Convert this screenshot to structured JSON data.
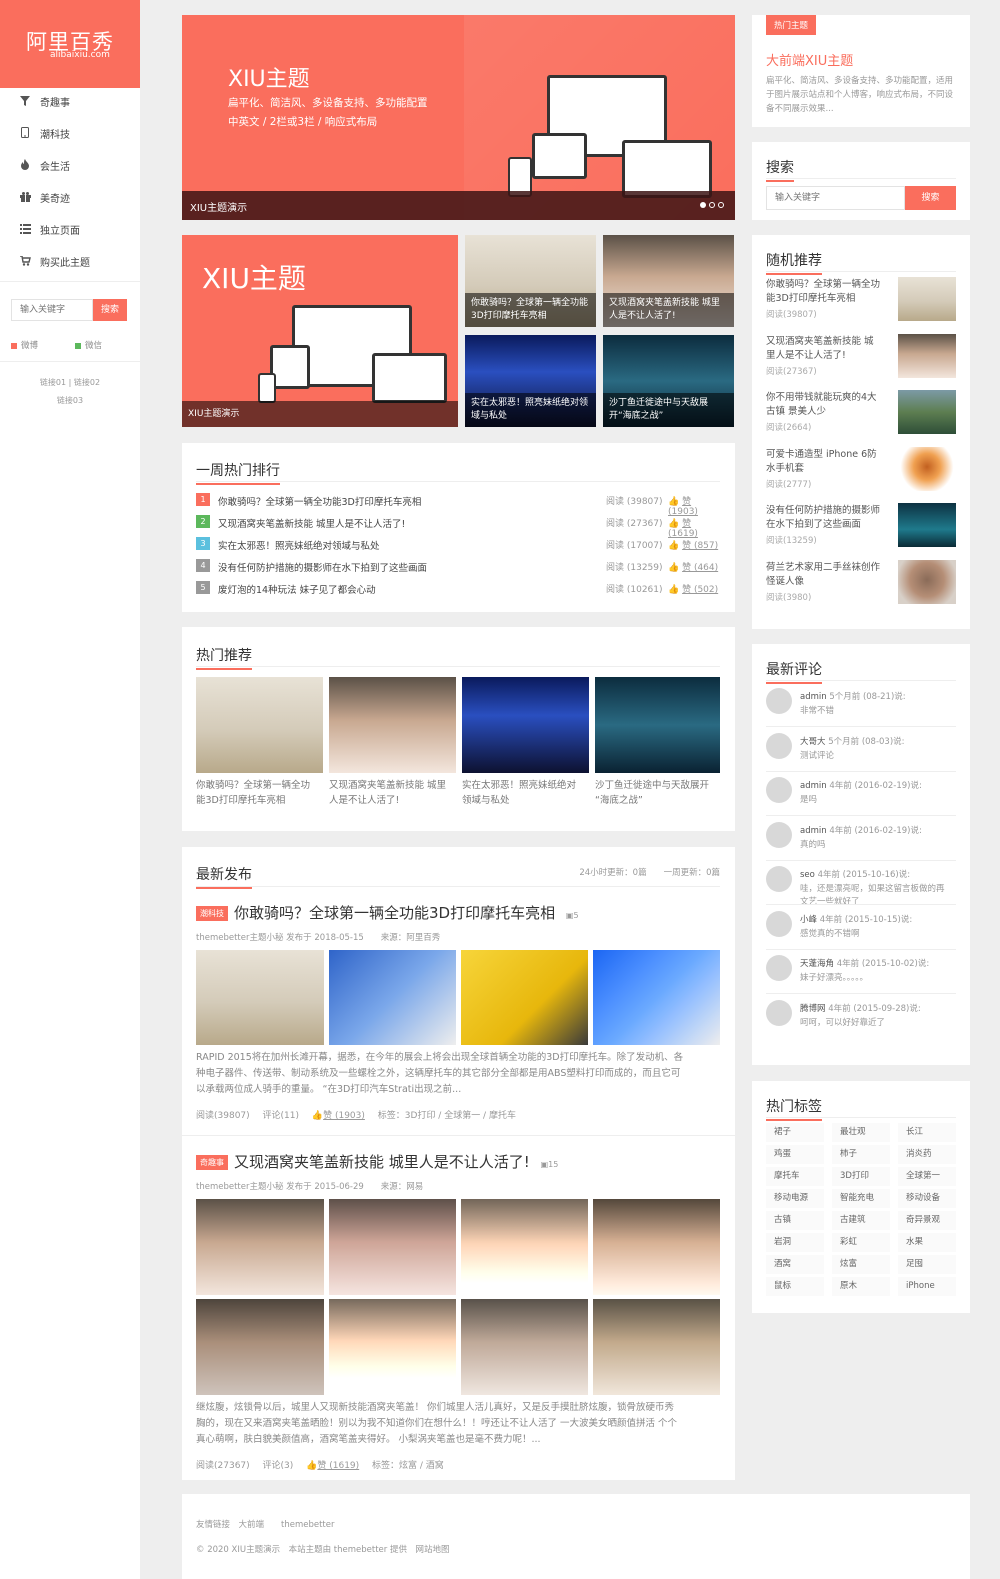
{
  "logo": {
    "title": "阿里百秀",
    "subtitle": "alibaixiu.com"
  },
  "nav": [
    {
      "icon": "filter-icon",
      "label": "奇趣事"
    },
    {
      "icon": "mobile-icon",
      "label": "潮科技"
    },
    {
      "icon": "fire-icon",
      "label": "会生活"
    },
    {
      "icon": "gift-icon",
      "label": "美奇迹"
    },
    {
      "icon": "list-icon",
      "label": "独立页面"
    },
    {
      "icon": "cart-icon",
      "label": "购买此主题"
    }
  ],
  "left_search": {
    "placeholder": "输入关键字",
    "button": "搜索"
  },
  "social": {
    "weibo": "微博",
    "weixin": "微信"
  },
  "left_links": {
    "line1": "链接01 | 链接02",
    "line2": "链接03"
  },
  "slider": {
    "heading": "XIU主题",
    "line1": "扁平化、简洁风、多设备支持、多功能配置",
    "line2": "中英文 / 2栏或3栏 / 响应式布局",
    "caption": "XIU主题演示"
  },
  "focus": {
    "big_heading": "XIU主题",
    "big_caption": "XIU主题演示",
    "tiles": [
      "你敢骑吗？全球第一辆全功能3D打印摩托车亮相",
      "又现酒窝夹笔盖新技能 城里人是不让人活了!",
      "实在太邪恶！照亮妹纸绝对领域与私处",
      "沙丁鱼迁徙途中与天敌展开“海底之战”"
    ]
  },
  "weekly": {
    "title": "一周热门排行",
    "rows": [
      {
        "num": "1",
        "color": "#fa6e5d",
        "title": "你敢骑吗？全球第一辆全功能3D打印摩托车亮相",
        "read": "阅读 (39807)",
        "like": "赞 (1903)"
      },
      {
        "num": "2",
        "color": "#5cb85c",
        "title": "又现酒窝夹笔盖新技能 城里人是不让人活了!",
        "read": "阅读 (27367)",
        "like": "赞 (1619)"
      },
      {
        "num": "3",
        "color": "#5bc0de",
        "title": "实在太邪恶！照亮妹纸绝对领域与私处",
        "read": "阅读 (17007)",
        "like": "赞 (857)"
      },
      {
        "num": "4",
        "color": "#999999",
        "title": "没有任何防护措施的摄影师在水下拍到了这些画面",
        "read": "阅读 (13259)",
        "like": "赞 (464)"
      },
      {
        "num": "5",
        "color": "#999999",
        "title": "废灯泡的14种玩法 妹子见了都会心动",
        "read": "阅读 (10261)",
        "like": "赞 (502)"
      }
    ]
  },
  "hot": {
    "title": "热门推荐",
    "items": [
      {
        "line1": "你敢骑吗？全球第一辆全功",
        "line2": "能3D打印摩托车亮相"
      },
      {
        "line1": "又现酒窝夹笔盖新技能 城里",
        "line2": "人是不让人活了!"
      },
      {
        "line1": "实在太邪恶！照亮妹纸绝对",
        "line2": "领域与私处"
      },
      {
        "line1": "沙丁鱼迁徙途中与天敌展开",
        "line2": "“海底之战”"
      }
    ]
  },
  "latest": {
    "title": "最新发布",
    "stats": "24小时更新：0篇　　一周更新：0篇",
    "posts": [
      {
        "badge": "潮科技",
        "title": "你敢骑吗？全球第一辆全功能3D打印摩托车亮相",
        "pics": "5",
        "meta": "themebetter主题小秘 发布于 2018-05-15　　来源：阿里百秀",
        "ex1": "RAPID 2015将在加州长滩开幕，据悉，在今年的展会上将会出现全球首辆全功能的3D打印摩托车。除了发动机、各",
        "ex2": "种电子器件、传送带、制动系统及一些螺栓之外，这辆摩托车的其它部分全部都是用ABS塑料打印而成的，而且它可",
        "ex3": "以承载两位成人骑手的重量。 “在3D打印汽车Strati出现之前...",
        "read": "阅读(39807)",
        "comment": "评论(11)",
        "like": "赞 (1903)",
        "tags": "标签：3D打印 / 全球第一 / 摩托车"
      },
      {
        "badge": "奇趣事",
        "title": "又现酒窝夹笔盖新技能 城里人是不让人活了!",
        "pics": "15",
        "meta": "themebetter主题小秘 发布于 2015-06-29　　来源：网易",
        "ex1": "继炫腹，炫锁骨以后，城里人又现新技能酒窝夹笔盖！ 你们城里人活儿真好，又是反手摸肚脐炫腹，锁骨放硬币秀",
        "ex2": "胸的，现在又来酒窝夹笔盖晒脸！别以为我不知道你们在想什么！！哼还让不让人活了 一大波美女晒颜值拼活 个个",
        "ex3": "真心萌啊，肤白貌美颜值高，酒窝笔盖夹得好。 小梨涡夹笔盖也是毫不费力呢！...",
        "read": "阅读(27367)",
        "comment": "评论(3)",
        "like": "赞 (1619)",
        "tags": "标签：炫富 / 酒窝"
      }
    ]
  },
  "footer": {
    "links": "友情链接　大前端　　themebetter",
    "copy": "© 2020 XIU主题演示　本站主题由 themebetter 提供　网站地图"
  },
  "ad": {
    "badge": "热门主题",
    "title": "大前端XIU主题",
    "desc1": "扁平化、简洁风、多设备支持、多功能配置，适用",
    "desc2": "于图片展示站点和个人博客，响应式布局，不同设",
    "desc3": "备不同展示效果..."
  },
  "right_search": {
    "title": "搜索",
    "placeholder": "输入关键字",
    "button": "搜索"
  },
  "random": {
    "title": "随机推荐",
    "items": [
      {
        "l1": "你敢骑吗？全球第一辆全功",
        "l2": "能3D打印摩托车亮相",
        "read": "阅读(39807)"
      },
      {
        "l1": "又现酒窝夹笔盖新技能 城",
        "l2": "里人是不让人活了!",
        "read": "阅读(27367)"
      },
      {
        "l1": "你不用带钱就能玩爽的4大",
        "l2": "古镇 景美人少",
        "read": "阅读(2664)"
      },
      {
        "l1": "可爱卡通造型 iPhone 6防",
        "l2": "水手机套",
        "read": "阅读(2777)"
      },
      {
        "l1": "没有任何防护措施的摄影师",
        "l2": "在水下拍到了这些画面",
        "read": "阅读(13259)"
      },
      {
        "l1": "荷兰艺术家用二手丝袜创作",
        "l2": "怪诞人像",
        "read": "阅读(3980)"
      }
    ]
  },
  "comments": {
    "title": "最新评论",
    "items": [
      {
        "user": "admin",
        "when": "5个月前 (08-21)说:",
        "text": "非常不错"
      },
      {
        "user": "大哥大",
        "when": "5个月前 (08-03)说:",
        "text": "测试评论"
      },
      {
        "user": "admin",
        "when": "4年前 (2016-02-19)说:",
        "text": "是吗"
      },
      {
        "user": "admin",
        "when": "4年前 (2016-02-19)说:",
        "text": "真的吗"
      },
      {
        "user": "seo",
        "when": "4年前 (2015-10-16)说:",
        "text": "哇，还是漂亮呢，如果这留言板做的再",
        "text2": "文艺一些就好了"
      },
      {
        "user": "小峰",
        "when": "4年前 (2015-10-15)说:",
        "text": "感觉真的不错啊"
      },
      {
        "user": "天蓬海角",
        "when": "4年前 (2015-10-02)说:",
        "text": "妹子好漂亮。。。。。"
      },
      {
        "user": "腾博网",
        "when": "4年前 (2015-09-28)说:",
        "text": "呵呵，可以好好靠近了"
      }
    ]
  },
  "tags": {
    "title": "热门标签",
    "items": [
      "裙子",
      "最壮观",
      "长江",
      "鸡蛋",
      "柿子",
      "消炎药",
      "摩托车",
      "3D打印",
      "全球第一",
      "移动电源",
      "智能充电",
      "移动设备",
      "古镇",
      "古建筑",
      "奇异景观",
      "岩洞",
      "彩虹",
      "水果",
      "酒窝",
      "炫富",
      "足囤",
      "鼠标",
      "原木",
      "iPhone"
    ]
  },
  "colors": {
    "accent": "#fa6e5d",
    "green": "#5cb85c",
    "cyan": "#5bc0de"
  }
}
